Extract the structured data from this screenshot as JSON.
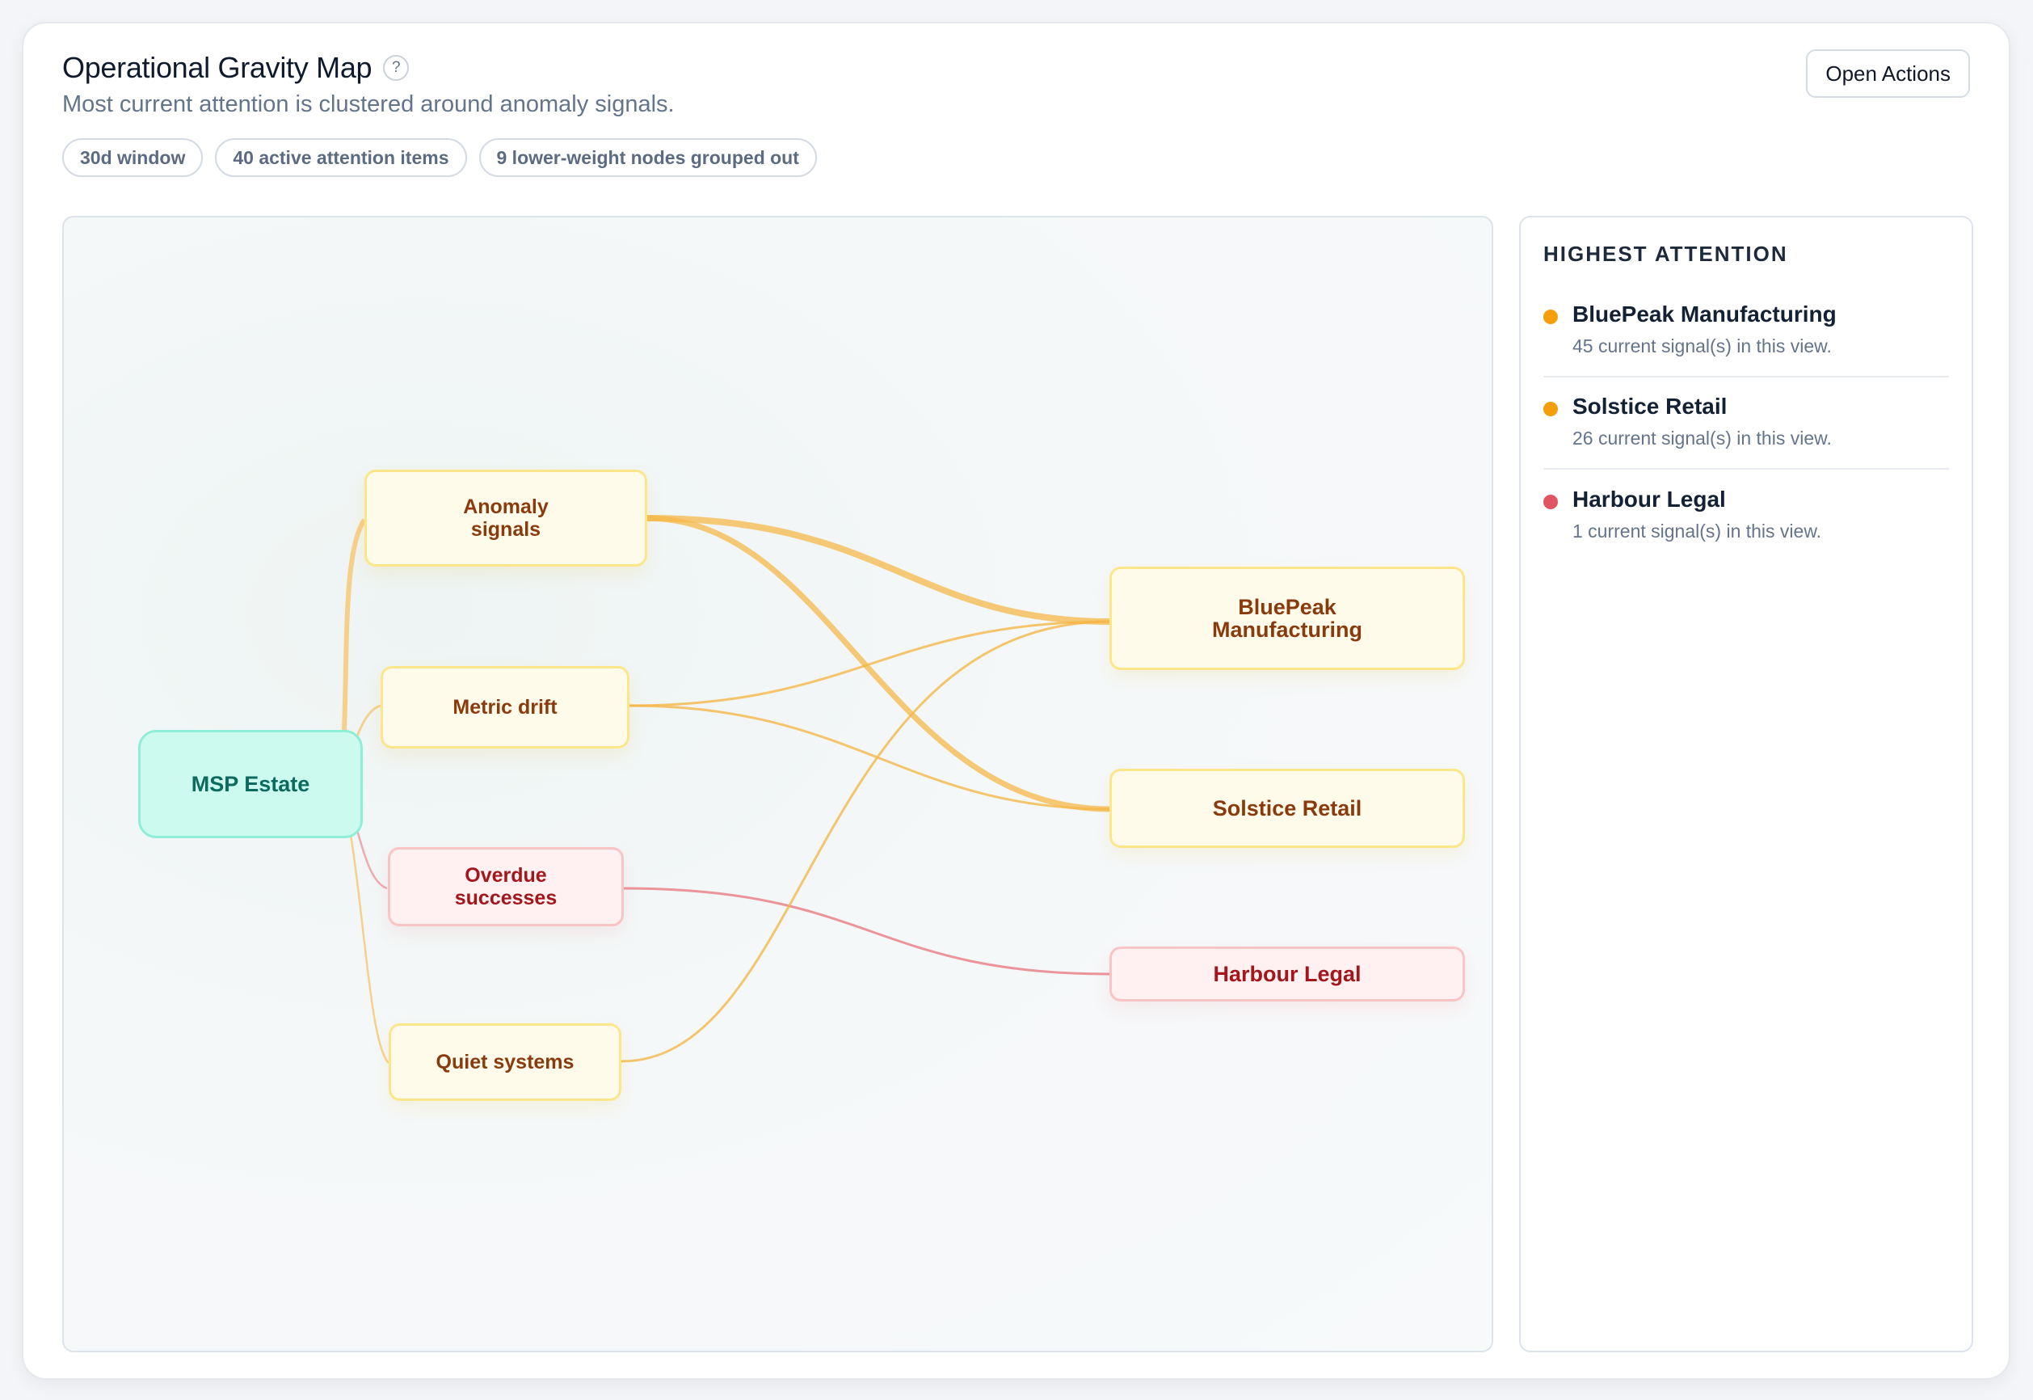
{
  "header": {
    "title": "Operational Gravity Map",
    "help_glyph": "?",
    "subtitle": "Most current attention is clustered around anomaly signals.",
    "open_actions_label": "Open Actions"
  },
  "chips": [
    "30d window",
    "40 active attention items",
    "9 lower-weight nodes grouped out"
  ],
  "map": {
    "root": "MSP Estate",
    "categories": [
      {
        "id": "anomaly",
        "label": "Anomaly signals",
        "severity": "warn"
      },
      {
        "id": "drift",
        "label": "Metric drift",
        "severity": "warn"
      },
      {
        "id": "overdue",
        "label": "Overdue successes",
        "severity": "critical"
      },
      {
        "id": "quiet",
        "label": "Quiet systems",
        "severity": "warn"
      }
    ],
    "targets": [
      {
        "id": "bluepeak",
        "label": "BluePeak Manufacturing",
        "severity": "warn"
      },
      {
        "id": "solstice",
        "label": "Solstice Retail",
        "severity": "warn"
      },
      {
        "id": "harbour",
        "label": "Harbour Legal",
        "severity": "critical"
      }
    ],
    "links": [
      {
        "from": "anomaly",
        "to": "bluepeak",
        "weight": "heavy"
      },
      {
        "from": "anomaly",
        "to": "solstice",
        "weight": "heavy"
      },
      {
        "from": "drift",
        "to": "bluepeak",
        "weight": "light"
      },
      {
        "from": "drift",
        "to": "solstice",
        "weight": "light"
      },
      {
        "from": "overdue",
        "to": "harbour",
        "weight": "light"
      },
      {
        "from": "quiet",
        "to": "bluepeak",
        "weight": "light"
      }
    ],
    "colors": {
      "warn": "#f5b84a",
      "critical": "#ea8a8f"
    }
  },
  "side": {
    "heading": "HIGHEST ATTENTION",
    "items": [
      {
        "name": "BluePeak Manufacturing",
        "desc": "45 current signal(s) in this view.",
        "color": "#f59e0b"
      },
      {
        "name": "Solstice Retail",
        "desc": "26 current signal(s) in this view.",
        "color": "#f59e0b"
      },
      {
        "name": "Harbour Legal",
        "desc": "1 current signal(s) in this view.",
        "color": "#e05561"
      }
    ]
  }
}
